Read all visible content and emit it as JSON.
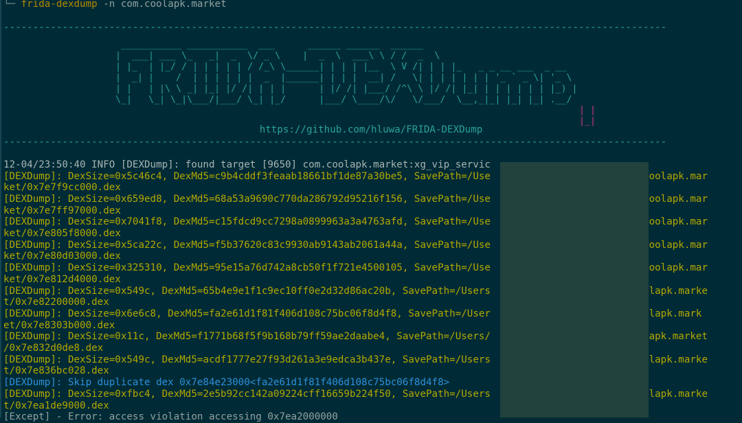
{
  "command": {
    "prompt_glyph": "└─",
    "program": "frida-dexdump",
    "args": "-n com.coolapk.market"
  },
  "separator": "-----------------------------------------------------------------------------------------------------------------",
  "banner": {
    "ascii_cyan": " ___________ ___________  ___      ______ ______  ______\n|  ___| ___ \\_   _|  _  \\/ _ \\    |  _  \\  ___\\ \\ / /  _  \\\n| |_  | |_/ / | | | | | / /_\\ \\______| | | | |__  \\ V /| | | |_   _ _ __ ___  _ __\n|  _| |    /  | | | | | |  _  |______| | | |  __| /   \\| | | | | | | '_ ` _ \\| '_ \\\n| |   | |\\ \\ _| |_| |/ /| | | |      | |/ /| |___/ /^\\ \\ |/ /| |_| | | | | | | |_) |\n\\_|   \\_| \\_|\\___/|___/ \\_| |_/      |___/ \\____/\\/   \\/___/  \\__,_|_| |_| |_| .__/",
    "ascii_red": "| |\n|_|",
    "url": "https://github.com/hluwa/FRIDA-DEXDump"
  },
  "log": {
    "info": "12-04/23:50:40 INFO [DEXDump]: found target [9650] com.coolapk.market:xg_vip_servic",
    "lines": [
      {
        "kind": "log",
        "text": "[DEXDump]: DexSize=0x5c46c4, DexMd5=c9b4cddf3feaab18661bf1de87a30be5, SavePath=/Use                     /com.coolapk.mar"
      },
      {
        "kind": "log",
        "text": "ket/0x7e7f9cc000.dex"
      },
      {
        "kind": "log",
        "text": "[DEXDump]: DexSize=0x659ed8, DexMd5=68a53a9690c770da286792d95216f156, SavePath=/Use                     /com.coolapk.mar"
      },
      {
        "kind": "log",
        "text": "ket/0x7e7ff97000.dex"
      },
      {
        "kind": "log",
        "text": "[DEXDump]: DexSize=0x7041f8, DexMd5=c15fdcd9cc7298a0899963a3a4763afd, SavePath=/Use                     /com.coolapk.mar"
      },
      {
        "kind": "log",
        "text": "ket/0x7e805f8000.dex"
      },
      {
        "kind": "log",
        "text": "[DEXDump]: DexSize=0x5ca22c, DexMd5=f5b37620c83c9930ab9143ab2061a44a, SavePath=/Use                     /com.coolapk.mar"
      },
      {
        "kind": "log",
        "text": "ket/0x7e80d03000.dex"
      },
      {
        "kind": "log",
        "text": "[DEXDump]: DexSize=0x325310, DexMd5=95e15a76d742a8cb50f1f721e4500105, SavePath=/Use                     /com.coolapk.mar"
      },
      {
        "kind": "log",
        "text": "ket/0x7e812d4000.dex"
      },
      {
        "kind": "log",
        "text": "[DEXDump]: DexSize=0x549c, DexMd5=65b4e9e1f1c9ec10ff0e2d32d86ac20b, SavePath=/Users                     om.coolapk.marke"
      },
      {
        "kind": "log",
        "text": "t/0x7e82200000.dex"
      },
      {
        "kind": "log",
        "text": "[DEXDump]: DexSize=0x6e6c8, DexMd5=fa2e61d1f81f406d108c75bc06f8d4f8, SavePath=/User                     om.coolapk.mark"
      },
      {
        "kind": "log",
        "text": "et/0x7e8303b000.dex"
      },
      {
        "kind": "log",
        "text": "[DEXDump]: DexSize=0x11c, DexMd5=f1771b68f5f9b168b79ff59ae2daabe4, SavePath=/Users/                     n.coolapk.market"
      },
      {
        "kind": "log",
        "text": "/0x7e832d0de8.dex"
      },
      {
        "kind": "log",
        "text": "[DEXDump]: DexSize=0x549c, DexMd5=acdf1777e27f93d261a3e9edca3b437e, SavePath=/Users                     om.coolapk.marke"
      },
      {
        "kind": "log",
        "text": "t/0x7e836bc028.dex"
      },
      {
        "kind": "skip",
        "text": "[DEXDump]: Skip duplicate dex 0x7e84e23000<fa2e61d1f81f406d108c75bc06f8d4f8>"
      },
      {
        "kind": "log",
        "text": "[DEXDump]: DexSize=0xfbc4, DexMd5=2e5b92cc142a09224cff16659b224f50, SavePath=/Users                     om.coolapk.marke"
      },
      {
        "kind": "log",
        "text": "t/0x7ea1de9000.dex"
      },
      {
        "kind": "err",
        "text": "[Except] - Error: access violation accessing 0x7ea2000000"
      }
    ]
  },
  "colors": {
    "background": "#002b36",
    "accent": "#2aa198",
    "log": "#b4a800",
    "skip": "#2f8fd8",
    "banner_red": "#d33682"
  }
}
